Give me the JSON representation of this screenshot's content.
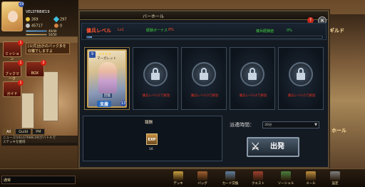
{
  "player": {
    "name": "VELSTRBIE19",
    "level": "19",
    "gold": "269",
    "gems": "297",
    "coins": "45717",
    "coins2": "0",
    "stamina": "40/40",
    "ap": "50/50"
  },
  "side_menu": [
    {
      "label": "ミッション",
      "badge": "1"
    },
    {
      "label": "ブックマーク",
      "badge": "1"
    },
    {
      "label": "BOX",
      "badge": "2"
    },
    {
      "label": "ガイド",
      "badge": "1"
    }
  ],
  "notice": "[公式]合計のパック多を収穫でしますよ",
  "chat": {
    "tabs": [
      "All",
      "Guild",
      "PM"
    ],
    "active_tab": "All",
    "messages": [
      "ニュース[VELSTRBIE19]がバトルで",
      "ステッキを獲得"
    ],
    "channel": "通常",
    "input_placeholder": ""
  },
  "modal": {
    "title": "バーホール",
    "level_label": "傭兵レベル",
    "level_value": "Lv1",
    "bonus_label": "経験ボーナス",
    "bonus_value": "0%",
    "progress_label": "傭兵経験値",
    "progress_value": "0%",
    "progress_fraction": 0.0,
    "close": "×",
    "help": "?"
  },
  "card": {
    "number": "9",
    "name": "マーガレット",
    "stars": "★★★★",
    "role": "回復",
    "type": "支援",
    "level": "13"
  },
  "locked_slots": [
    {
      "text": "傭兵レベル2で解放"
    },
    {
      "text": "傭兵レベル3で解放"
    },
    {
      "text": "傭兵レベル4で解放"
    },
    {
      "text": "傭兵レベル5で解放"
    }
  ],
  "reward": {
    "title": "報酬",
    "exp_icon": "EXP",
    "exp_value": "16"
  },
  "dispatch": {
    "label": "派遣時間：",
    "selected": "30分",
    "button": "出発"
  },
  "right_labels": {
    "guild": "ギルド",
    "hall": "ホール"
  },
  "bottom_nav": [
    {
      "label": "デッキ",
      "color": "#c8a040"
    },
    {
      "label": "バッグ",
      "color": "#a06030"
    },
    {
      "label": "カード交換",
      "color": "#6080a0"
    },
    {
      "label": "クエスト",
      "color": "#a04030"
    },
    {
      "label": "ソーシャル",
      "color": "#4a8040"
    },
    {
      "label": "メール",
      "color": "#c09040"
    },
    {
      "label": "設定",
      "color": "#808080"
    }
  ]
}
